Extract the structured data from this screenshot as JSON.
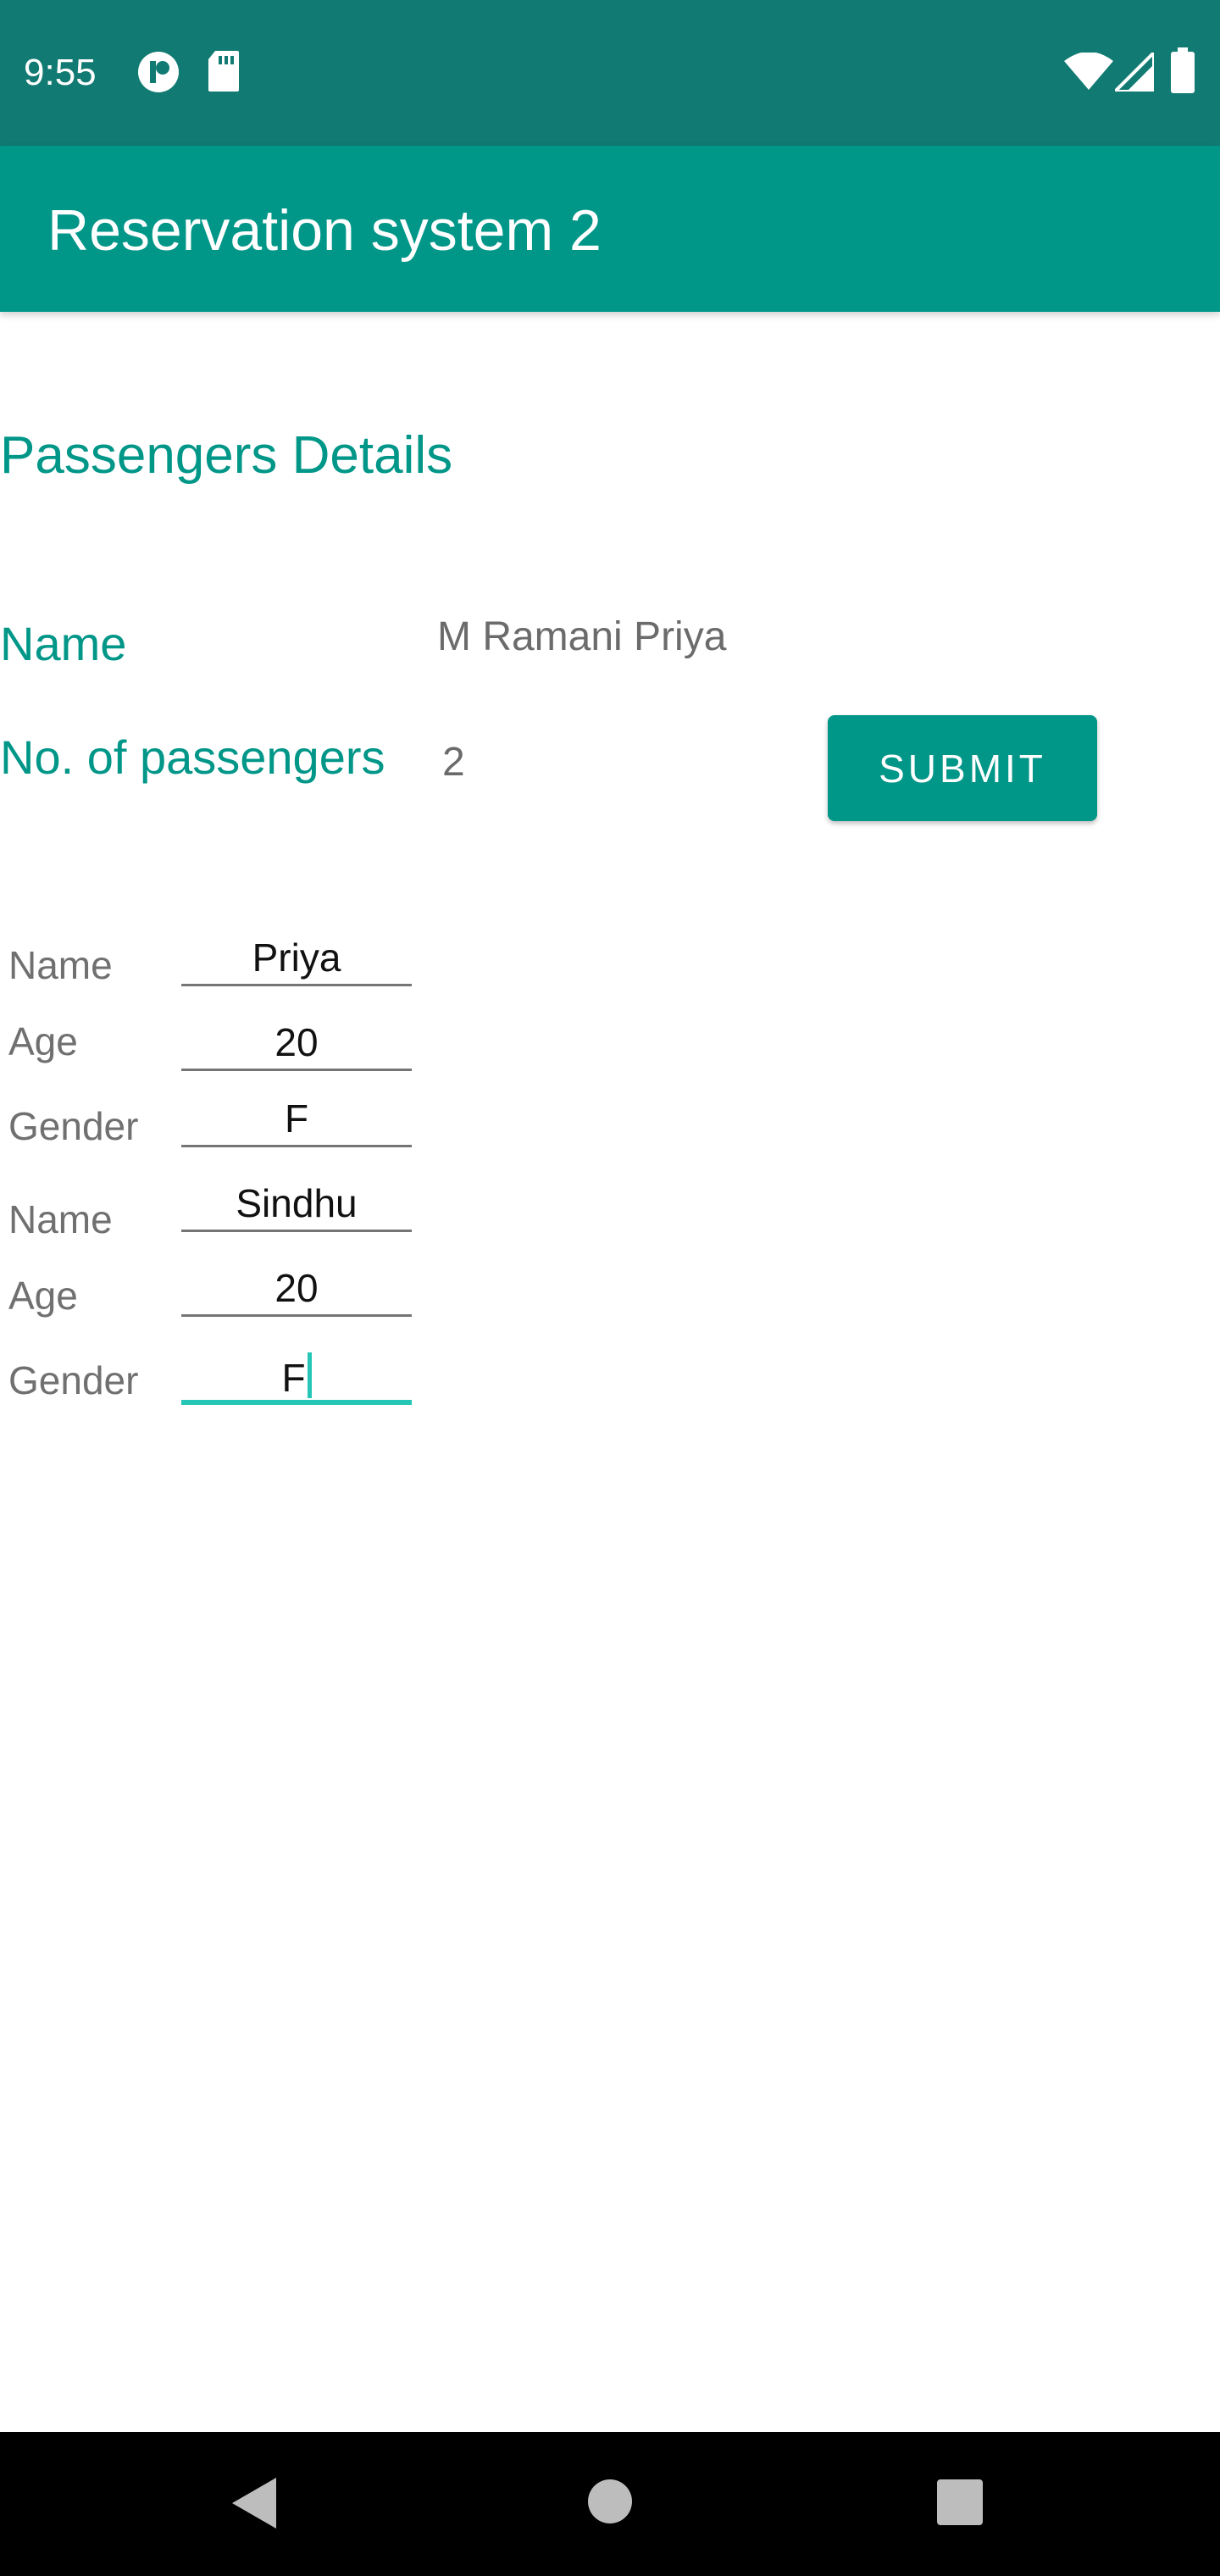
{
  "status_bar": {
    "time": "9:55",
    "left_icons": [
      "privacy-icon",
      "sd-card-icon"
    ],
    "right_icons": [
      "wifi-icon",
      "signal-icon",
      "battery-icon"
    ]
  },
  "app_bar": {
    "title": "Reservation system 2"
  },
  "main": {
    "section_title": "Passengers Details",
    "name_label": "Name",
    "name_value": "M Ramani Priya",
    "count_label": "No. of passengers",
    "count_value": "2",
    "submit_label": "SUBMIT"
  },
  "passengers": [
    {
      "name_label": "Name",
      "name": "Priya",
      "age_label": "Age",
      "age": "20",
      "gender_label": "Gender",
      "gender": "F"
    },
    {
      "name_label": "Name",
      "name": "Sindhu",
      "age_label": "Age",
      "age": "20",
      "gender_label": "Gender",
      "gender": "F"
    }
  ],
  "nav_bar": {
    "buttons": [
      "back-icon",
      "home-icon",
      "recents-icon"
    ]
  },
  "colors": {
    "status_bar": "#117a72",
    "primary": "#009688",
    "accent": "#26c6b6"
  }
}
